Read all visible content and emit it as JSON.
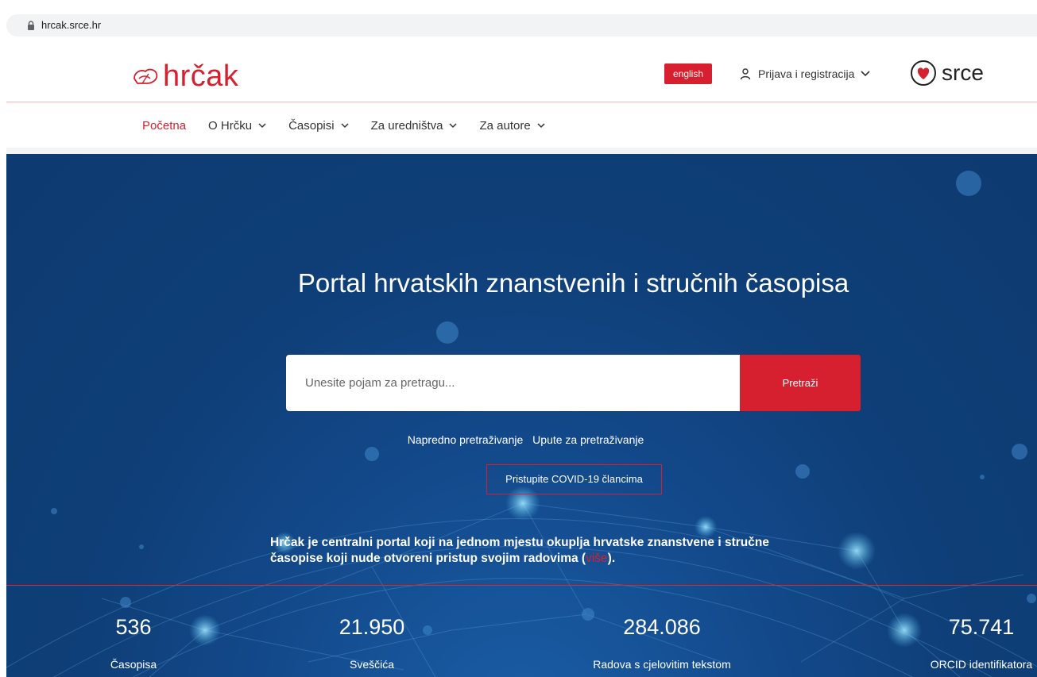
{
  "browser": {
    "url": "hrcak.srce.hr"
  },
  "header": {
    "logo_text": "hrčak",
    "lang_button": "english",
    "login_label": "Prijava i registracija",
    "partner_logo_text": "srce"
  },
  "nav": {
    "items": [
      {
        "label": "Početna",
        "active": true,
        "dropdown": false
      },
      {
        "label": "O Hrčku",
        "active": false,
        "dropdown": true
      },
      {
        "label": "Časopisi",
        "active": false,
        "dropdown": true
      },
      {
        "label": "Za uredništva",
        "active": false,
        "dropdown": true
      },
      {
        "label": "Za autore",
        "active": false,
        "dropdown": true
      }
    ]
  },
  "hero": {
    "title": "Portal hrvatskih znanstvenih i stručnih časopisa",
    "search_placeholder": "Unesite pojam za pretragu...",
    "search_button": "Pretraži",
    "advanced_search": "Napredno pretraživanje",
    "search_help": "Upute za pretraživanje",
    "covid_button": "Pristupite COVID-19 člancima",
    "description_line1": "Hrčak je centralni portal koji na jednom mjestu okuplja hrvatske znanstvene i stručne",
    "description_line2_start": "časopise koji nude otvoreni pristup svojim radovima (",
    "description_more_link": "više",
    "description_line2_end": ")."
  },
  "stats": [
    {
      "value": "536",
      "label": "Časopisa"
    },
    {
      "value": "21.950",
      "label": "Sveščića"
    },
    {
      "value": "284.086",
      "label": "Radova s cjelovitim tekstom"
    },
    {
      "value": "75.741",
      "label": "ORCID identifikatora"
    }
  ],
  "colors": {
    "brand_red": "#d6202f",
    "hero_blue": "#0f3f78"
  },
  "icons": {
    "lock": "lock-icon",
    "user": "user-icon",
    "chevron": "chevron-down-icon"
  }
}
